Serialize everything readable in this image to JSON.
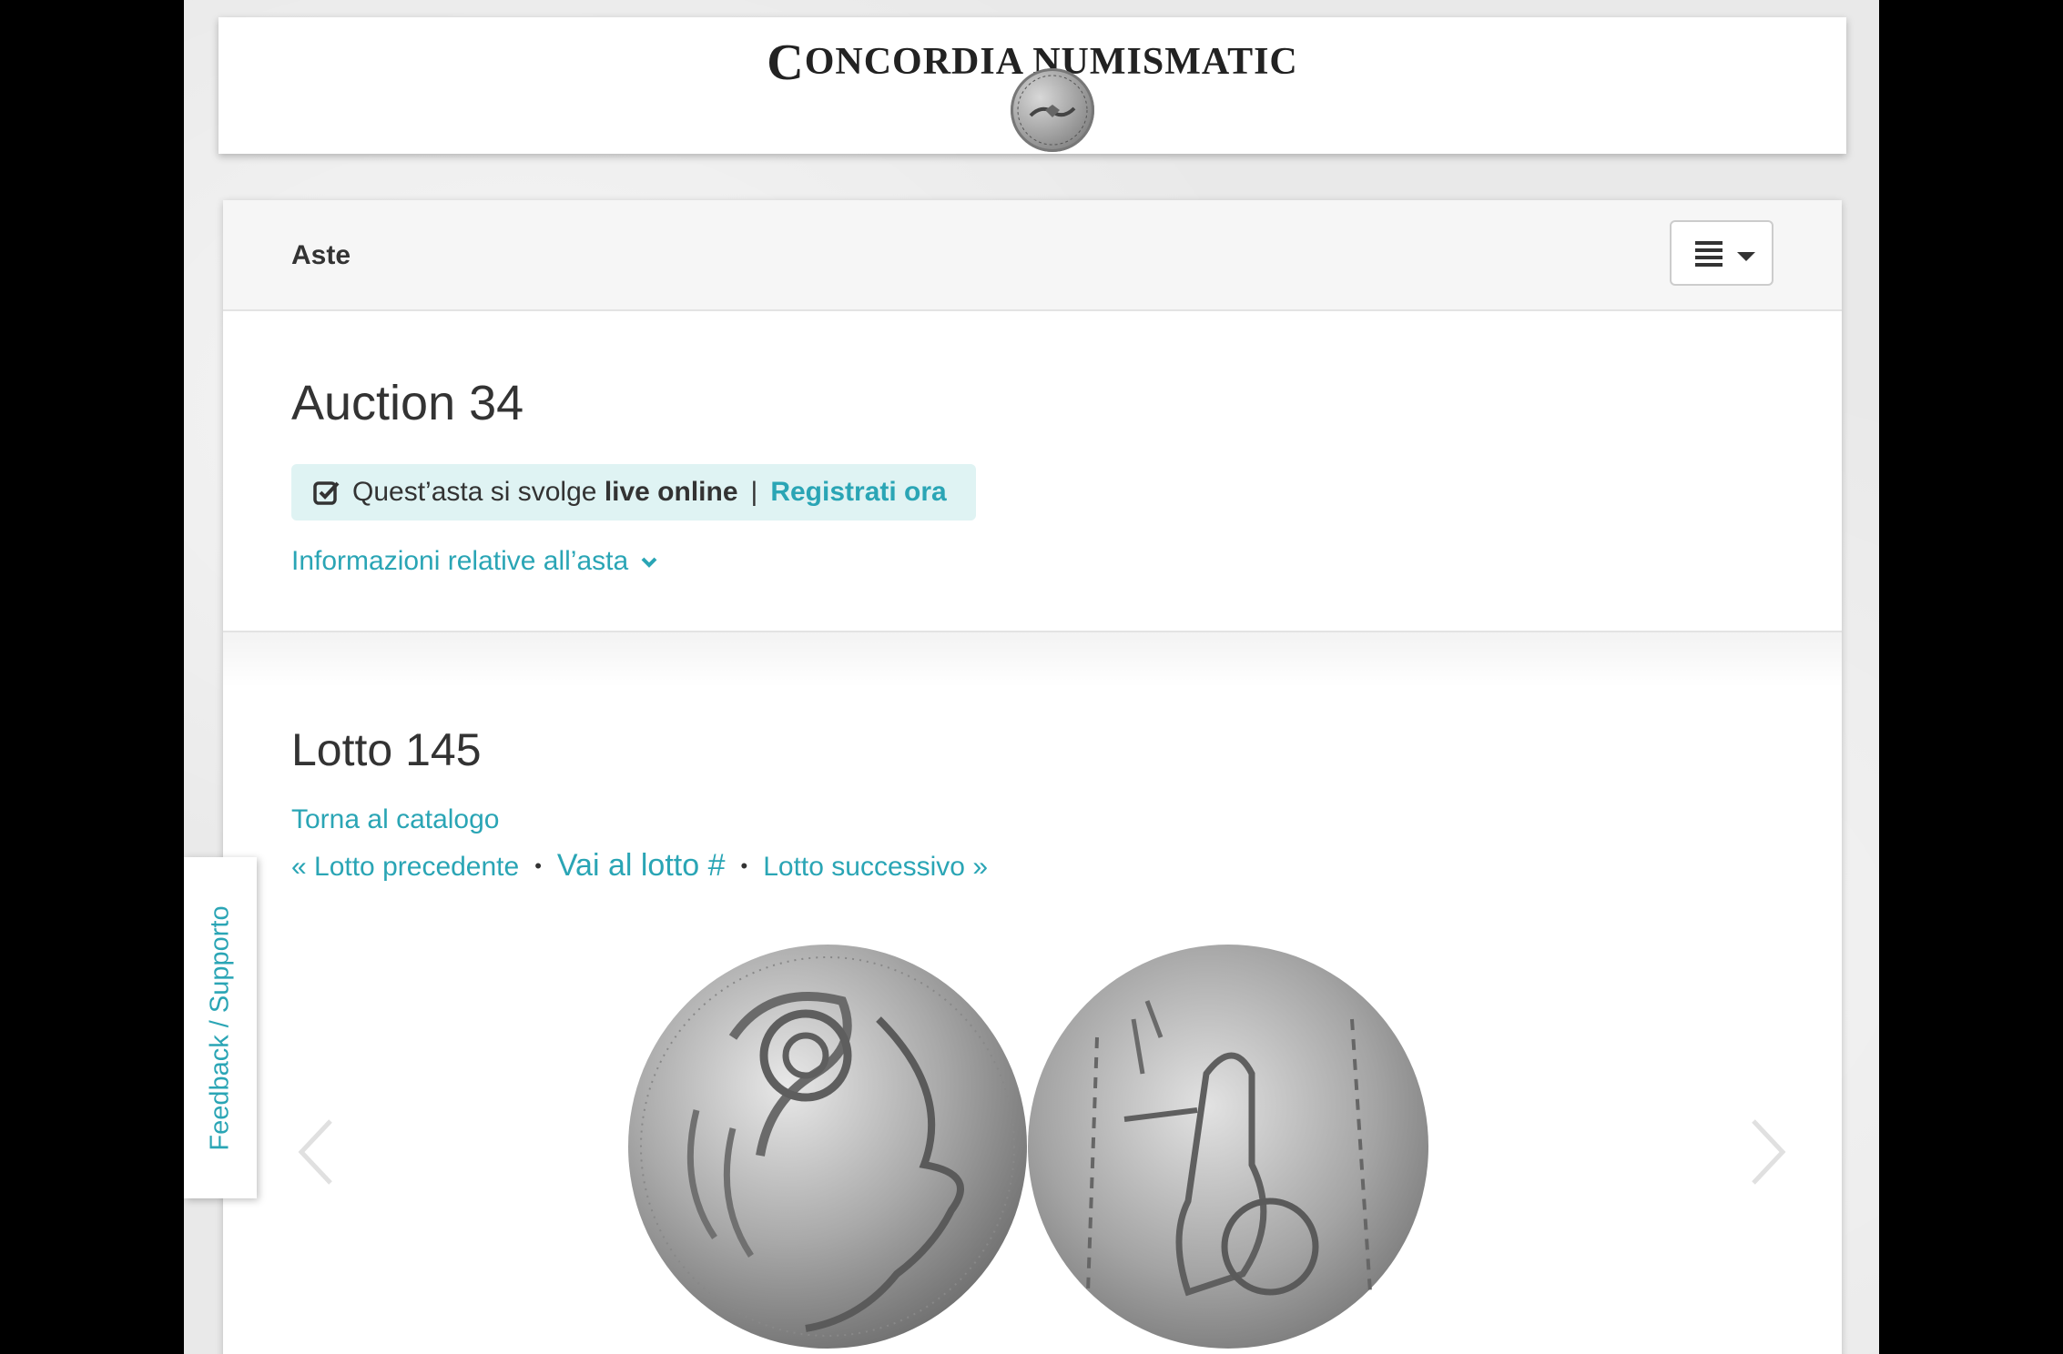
{
  "brand": {
    "name": "ONCORDIA NUMISMATIC",
    "initial": "C"
  },
  "navbar": {
    "title": "Aste",
    "menu_icon": "list-icon"
  },
  "auction": {
    "title": "Auction 34",
    "live_prefix": "Quest’asta si svolge",
    "live_strong": "live online",
    "separator": "|",
    "register_label": "Registrati ora",
    "info_label": "Informazioni relative all’asta"
  },
  "lot": {
    "title": "Lotto 145",
    "back_label": "Torna al catalogo",
    "prev_label": "« Lotto precedente",
    "goto_label": "Vai al lotto #",
    "next_label": "Lotto successivo »",
    "dot": "•"
  },
  "feedback": {
    "label": "Feedback / Supporto"
  },
  "colors": {
    "link": "#2aa5b5",
    "live_box_bg": "#dff3f3",
    "text": "#333333"
  }
}
